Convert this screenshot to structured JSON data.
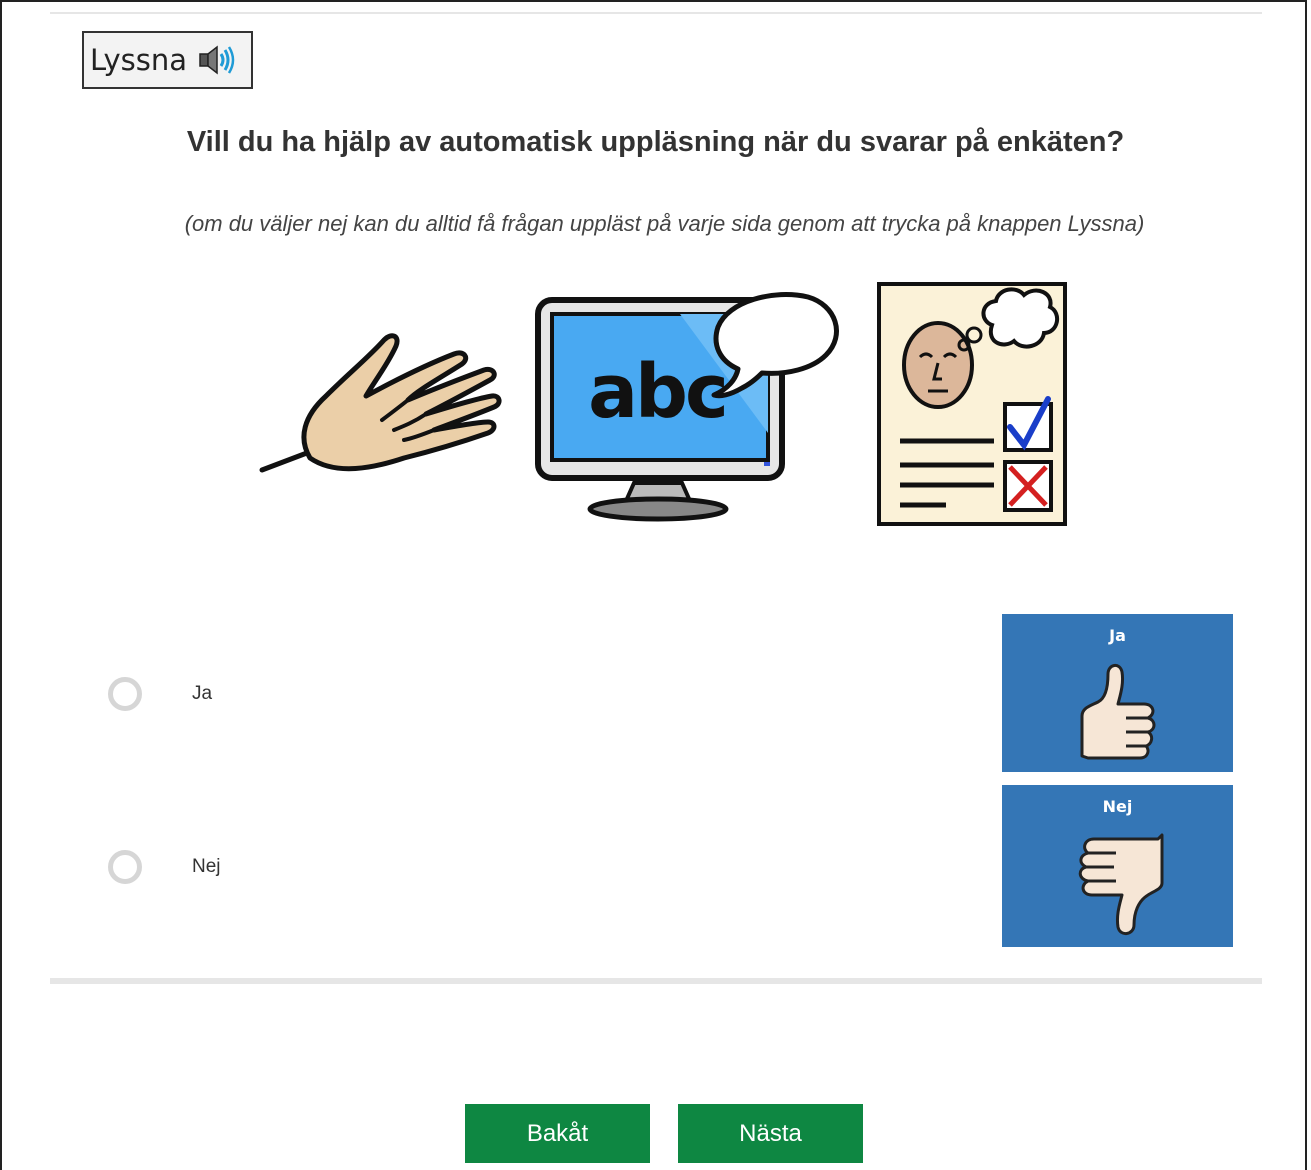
{
  "listen_button": {
    "label": "Lyssna",
    "icon": "speaker-icon"
  },
  "question": "Vill du ha hjälp av automatisk uppläsning när du svarar på enkäten?",
  "hint": "(om du väljer nej kan du alltid få frågan uppläst på varje sida genom att trycka på knappen Lyssna)",
  "illustrations": {
    "hand": "hand-icon",
    "monitor": {
      "icon": "monitor-speech-icon",
      "text": "abc"
    },
    "survey": "survey-form-icon"
  },
  "options": [
    {
      "label": "Ja",
      "selected": false,
      "tile_label": "Ja",
      "tile_icon": "thumbs-up-icon"
    },
    {
      "label": "Nej",
      "selected": false,
      "tile_label": "Nej",
      "tile_icon": "thumbs-down-icon"
    }
  ],
  "nav": {
    "back_label": "Bakåt",
    "next_label": "Nästa"
  },
  "colors": {
    "tile_blue": "#3476b6",
    "button_green": "#0e8742",
    "radio_border": "#d6d6d6"
  }
}
